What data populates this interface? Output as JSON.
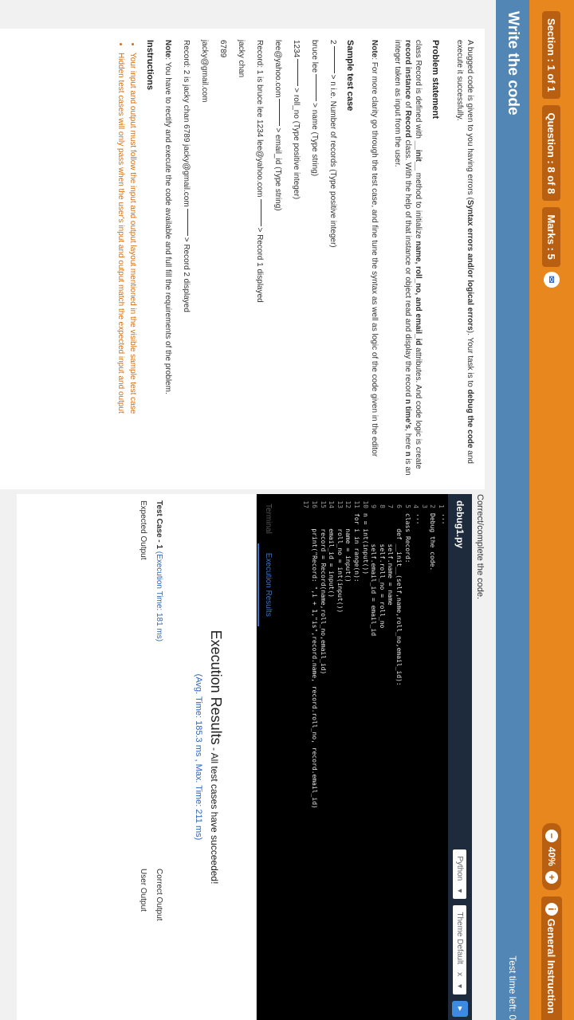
{
  "topbar": {
    "section": "Section : 1 of 1",
    "question": "Question : 8 of 8",
    "marks": "Marks : 5",
    "zoom": "40%",
    "minus": "−",
    "plus": "+",
    "general": "General Instruction",
    "info_glyph": "i",
    "chat_glyph": "✉"
  },
  "header": {
    "title": "Write the code",
    "timer": "Test time left: 0"
  },
  "problem": {
    "intro_a": "A bugged code is given to you having errors (",
    "intro_b": "Syntax errors and/or logical errors",
    "intro_c": "). Your task is to ",
    "intro_d": "debug the code",
    "intro_e": " and execute it successfully.",
    "statement_title": "Problem statement",
    "statement_1": "class Record is defined with ",
    "statement_init": "__init__",
    "statement_2": " method to initialize ",
    "statement_attrs": "name, roll_no, and email_id",
    "statement_3": " attributes. And code logic is create ",
    "statement_ri": "record instance",
    "statement_4": " of ",
    "statement_rc": "Record",
    "statement_5": " class. With the help of that instance or object read and display the record ",
    "statement_nt": "n time's",
    "statement_6": ", here ",
    "statement_n": "n",
    "statement_7": " is an integer taken as input from the user.",
    "note_label": "Note",
    "note_text": ": For more clarity go through the test case, and fine tune the syntax as well as logic of the code given in the editor",
    "sample_title": "Sample test case",
    "sample_lines": [
      {
        "left": "2",
        "right": "n i.e. Number of records (Type positive integer)"
      },
      {
        "left": "bruce lee",
        "right": "name (Type string)"
      },
      {
        "left": "1234",
        "right": "roll_no (Type positive integer)"
      },
      {
        "left": "lee@yahoo.com",
        "right": "email_id (Type string)"
      },
      {
        "left": "Record: 1 is bruce lee 1234 lee@yahoo.com",
        "right": "Record 1 displayed"
      }
    ],
    "plain_lines": [
      "jacky chan",
      "6789",
      "jacky@gmail.com"
    ],
    "record2_left": "Record: 2 is jacky chan 6789 jacky@gmail.com",
    "record2_right": "Record 2 displayed",
    "note2_label": "Note",
    "note2_text": ": You have to rectify and execute the code available and full fill the requirements of the problem.",
    "instructions_title": "Instructions",
    "instructions": [
      "Your input and output must follow the input and output layout mentioned in the visible sample test case",
      "Hidden test cases will only pass when the user's input and output match the expected input and output"
    ]
  },
  "editor": {
    "label": "Correct/complete the code.",
    "file": "debug1.py",
    "language": "Python",
    "theme": "Theme Default",
    "theme_x": "x",
    "dd_arrow": "▾",
    "lines": [
      {
        "n": "1",
        "t": "'''"
      },
      {
        "n": "2",
        "t": "Debug the code."
      },
      {
        "n": "3",
        "t": ""
      },
      {
        "n": "4",
        "t": "'''"
      },
      {
        "n": "5",
        "t": "class Record:"
      },
      {
        "n": "6",
        "t": "    def __init__(self,name,roll_no,email_id):"
      },
      {
        "n": "7",
        "t": "        self.name = name"
      },
      {
        "n": "8",
        "t": "        self.roll_no = roll_no"
      },
      {
        "n": "9",
        "t": "        self.email_id = email_id"
      },
      {
        "n": "10",
        "t": "n = int(input())"
      },
      {
        "n": "11",
        "t": "for i in range(n):"
      },
      {
        "n": "12",
        "t": "    name = input()"
      },
      {
        "n": "13",
        "t": "    roll_no = int(input())"
      },
      {
        "n": "14",
        "t": "    email_id = input()"
      },
      {
        "n": "15",
        "t": "    record = Record(name,roll_no,email_id)"
      },
      {
        "n": "16",
        "t": "    print(\"Record: \",i + 1,\"is\",record.name, record.roll_no, record.email_id)"
      },
      {
        "n": "17",
        "t": ""
      }
    ],
    "cursor": "I"
  },
  "results": {
    "tab_terminal": "Terminal",
    "tab_exec": "Execution Results",
    "title": "Execution Results",
    "subtitle": " - All test cases have succeeded!",
    "avg": "(Avg. Time: 185.3 ms , Max. Time: 211 ms)",
    "testcase_label": "Test Case - 1 ",
    "testcase_time": "(Execution Time: 181 ms)",
    "correct_output": "Correct Output",
    "expected_output": "Expected Output",
    "user_output": "User Output"
  }
}
